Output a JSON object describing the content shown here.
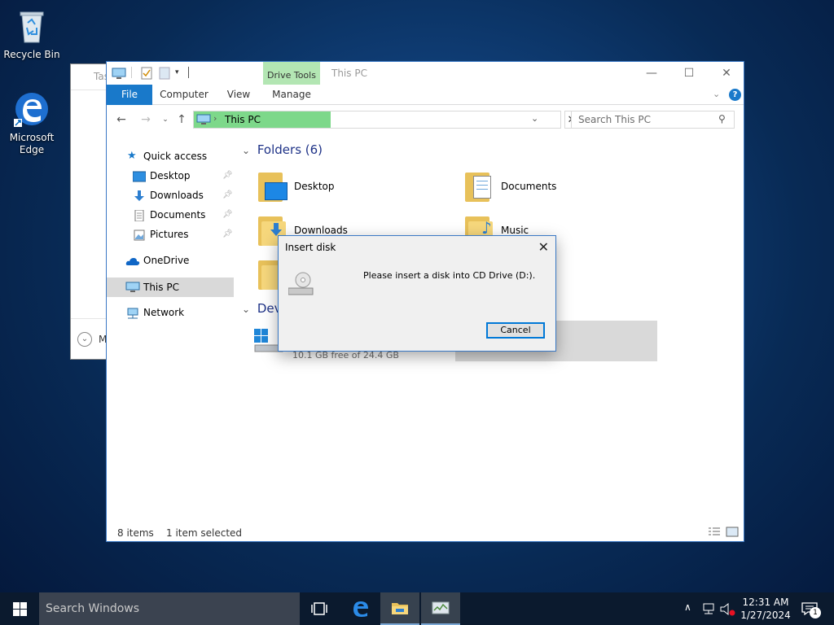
{
  "desktop": {
    "icons": [
      {
        "label": "Recycle Bin"
      },
      {
        "label": "Microsoft Edge"
      }
    ]
  },
  "background_window": {
    "title": "Tas",
    "footer_text": "M"
  },
  "explorer": {
    "window_title": "This PC",
    "contextual_tab": "Drive Tools",
    "ribbon_tabs": [
      "File",
      "Computer",
      "View",
      "Manage"
    ],
    "address": {
      "location": "This PC"
    },
    "search": {
      "placeholder": "Search This PC"
    },
    "nav_pane": {
      "quick_access": "Quick access",
      "items": [
        {
          "label": "Desktop",
          "pinned": true
        },
        {
          "label": "Downloads",
          "pinned": true
        },
        {
          "label": "Documents",
          "pinned": true
        },
        {
          "label": "Pictures",
          "pinned": true
        }
      ],
      "onedrive": "OneDrive",
      "this_pc": "This PC",
      "network": "Network"
    },
    "content": {
      "folders_header": "Folders (6)",
      "folders": [
        "Desktop",
        "Documents",
        "Downloads",
        "Music"
      ],
      "devices_header": "Devi",
      "drive_free": "10.1 GB free of 24.4 GB"
    },
    "status": {
      "items": "8 items",
      "selected": "1 item selected"
    }
  },
  "dialog": {
    "title": "Insert disk",
    "message": "Please insert a disk into CD Drive (D:).",
    "cancel_label": "Cancel"
  },
  "taskbar": {
    "search_placeholder": "Search Windows",
    "time": "12:31 AM",
    "date": "1/27/2024",
    "notification_count": "1"
  },
  "colors": {
    "accent": "#1979ca",
    "address_highlight": "#7dd88a",
    "context_tab": "#b3e6b3"
  }
}
